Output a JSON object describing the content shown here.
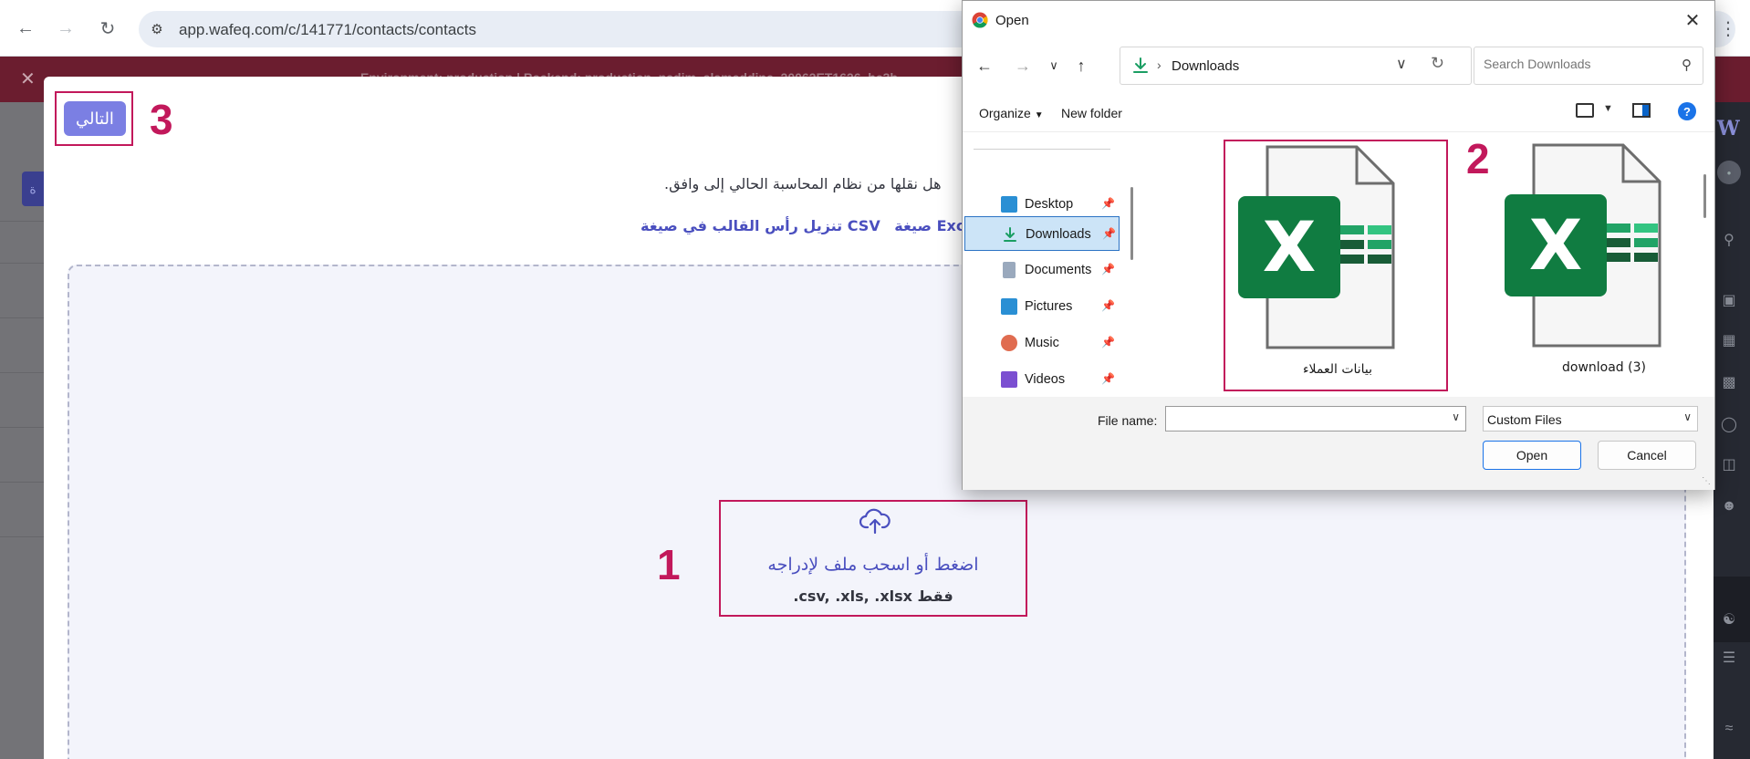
{
  "browser": {
    "url": "app.wafeq.com/c/141771/contacts/contacts"
  },
  "env_banner": {
    "text": "Environment: production   |   Backend: production_nadim_alameddine_20062ET1626_he3b..."
  },
  "modal": {
    "next_button": "التالي",
    "intro_text": "هل نقلها من نظام المحاسبة الحالي إلى وافق.",
    "link_csv": "تنزيل رأس القالب في صيغة CSV",
    "link_excel": "صيغة Excel",
    "upload_title": "اضغط أو اسحب ملف لإدراجه",
    "upload_formats": ".csv, .xls, .xlsx فقط"
  },
  "annotations": {
    "step1": "1",
    "step2": "2",
    "step3": "3",
    "color": "#c2185b"
  },
  "dialog": {
    "title": "Open",
    "address_crumb": "Downloads",
    "search_placeholder": "Search Downloads",
    "toolbar": {
      "organize": "Organize",
      "new_folder": "New folder"
    },
    "nav_items": [
      {
        "label": "Desktop",
        "icon": "desktop-icon"
      },
      {
        "label": "Downloads",
        "icon": "downloads-icon"
      },
      {
        "label": "Documents",
        "icon": "documents-icon"
      },
      {
        "label": "Pictures",
        "icon": "pictures-icon"
      },
      {
        "label": "Music",
        "icon": "music-icon"
      },
      {
        "label": "Videos",
        "icon": "videos-icon"
      }
    ],
    "files": [
      {
        "name": "بيانات العملاء",
        "icon": "excel-file-icon"
      },
      {
        "name": "download (3)",
        "icon": "excel-file-icon"
      }
    ],
    "file_name_label": "File name:",
    "file_name_value": "",
    "file_type": "Custom Files",
    "open_button": "Open",
    "cancel_button": "Cancel"
  },
  "colors": {
    "accent_purple": "#7b7fe3",
    "link_blue": "#4a4fbf",
    "excel_green": "#107c41"
  }
}
